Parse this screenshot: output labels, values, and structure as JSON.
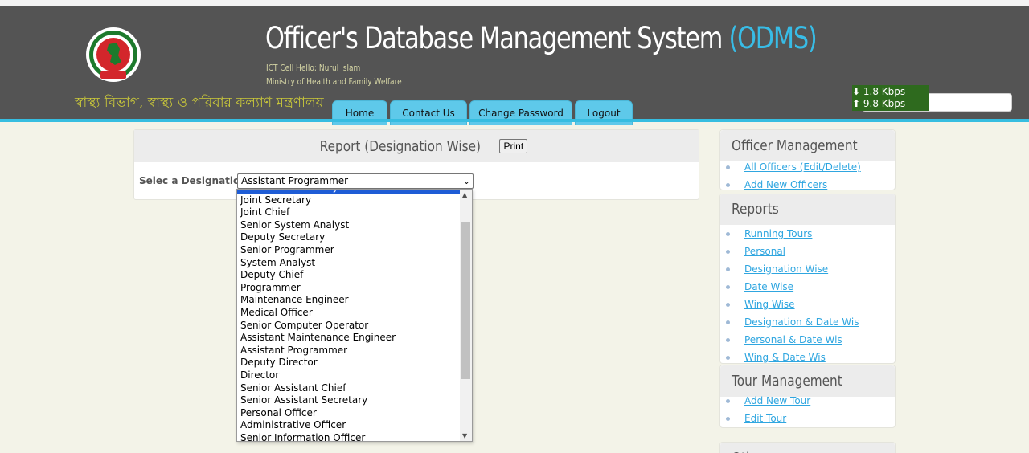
{
  "header": {
    "title_main": "Officer's Database Management System ",
    "title_accent": "(ODMS)",
    "subtitle_line1": "ICT Cell   Hello: Nurul Islam",
    "subtitle_line2": "Ministry of Health and Family Welfare",
    "bangla_title": "স্বাস্থ্য বিভাগ, স্বাস্থ্য ও পরিবার কল্যাণ মন্ত্রণালয়",
    "emblem": "government-emblem"
  },
  "nav": [
    {
      "label": "Home"
    },
    {
      "label": "Contact Us"
    },
    {
      "label": "Change Password"
    },
    {
      "label": "Logout"
    }
  ],
  "net_speed": {
    "down": "1.8 Kbps",
    "up": "9.8 Kbps"
  },
  "report": {
    "title": "Report (Designation Wise)",
    "print_label": "Print",
    "designation_label": "Selec a Designation:",
    "selected_value": "Assistant Programmer",
    "options": [
      "Additional Secretary",
      "Joint Secretary",
      "Joint Chief",
      "Senior System Analyst",
      "Deputy Secretary",
      "Senior Programmer",
      "System Analyst",
      "Deputy Chief",
      "Programmer",
      "Maintenance Engineer",
      "Medical Officer",
      "Senior Computer Operator",
      "Assistant Maintenance Engineer",
      "Assistant Programmer",
      "Deputy Director",
      "Director",
      "Senior Assistant Chief",
      "Senior Assistant Secretary",
      "Personal Officer",
      "Administrative Officer",
      "Senior Information Officer"
    ]
  },
  "sidebar": {
    "officer_management": {
      "title": "Officer Management",
      "links": [
        "All Officers (Edit/Delete)",
        "Add New Officers"
      ]
    },
    "reports": {
      "title": "Reports",
      "links": [
        "Running Tours",
        "Personal",
        "Designation Wise",
        "Date Wise",
        "Wing Wise",
        "Designation & Date Wis",
        "Personal & Date Wis",
        "Wing & Date Wis"
      ]
    },
    "tour_management": {
      "title": "Tour Management",
      "links": [
        "Add New Tour",
        "Edit Tour"
      ]
    },
    "others": {
      "title": "Oth"
    }
  }
}
